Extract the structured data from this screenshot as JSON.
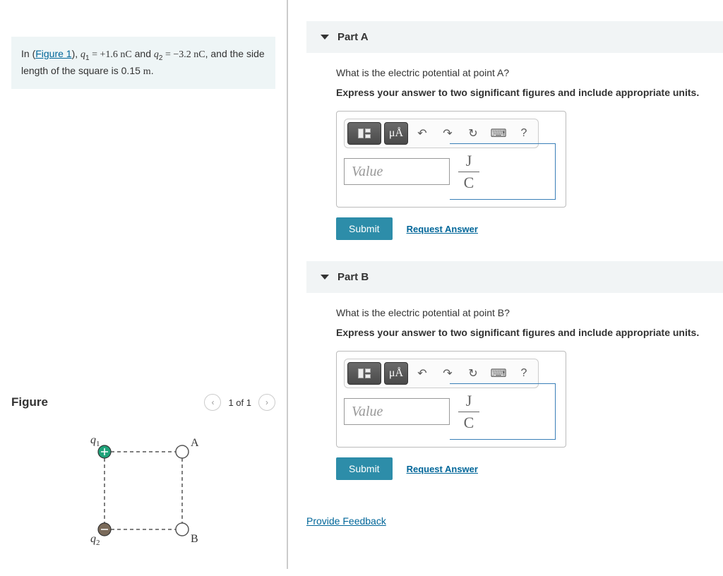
{
  "problem": {
    "prefix": "In (",
    "figlink": "Figure 1",
    "suffix1": "), ",
    "q1_var": "q",
    "q1_sub": "1",
    "eq": " = ",
    "q1_val": "+1.6 nC",
    "and": " and ",
    "q2_var": "q",
    "q2_sub": "2",
    "q2_val": "−3.2 nC",
    "tail": ", and the side length of the square is 0.15 ",
    "unit_m": "m",
    "period": "."
  },
  "figure": {
    "title": "Figure",
    "count": "1 of 1",
    "labels": {
      "q1": "q₁",
      "q2": "q₂",
      "A": "A",
      "B": "B"
    }
  },
  "partA": {
    "title": "Part A",
    "question": "What is the electric potential at point A?",
    "instruction": "Express your answer to two significant figures and include appropriate units.",
    "placeholder": "Value",
    "unit_top": "J",
    "unit_bot": "C",
    "submit": "Submit",
    "request": "Request Answer"
  },
  "partB": {
    "title": "Part B",
    "question": "What is the electric potential at point B?",
    "instruction": "Express your answer to two significant figures and include appropriate units.",
    "placeholder": "Value",
    "unit_top": "J",
    "unit_bot": "C",
    "submit": "Submit",
    "request": "Request Answer"
  },
  "toolbar": {
    "units_label": "μÅ"
  },
  "feedback": "Provide Feedback"
}
